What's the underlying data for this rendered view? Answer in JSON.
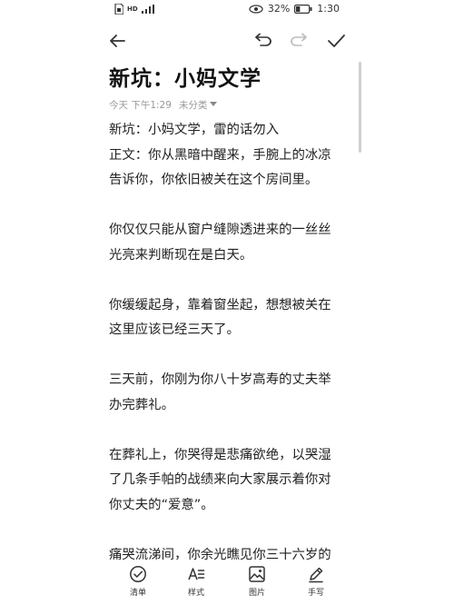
{
  "status_bar": {
    "signal_label": "HD",
    "battery_percent": "32%",
    "battery_level": 0.32,
    "time": "1:30"
  },
  "toolbar": {
    "icons": [
      "back-arrow-icon",
      "undo-icon",
      "redo-icon",
      "check-icon"
    ]
  },
  "note": {
    "title": "新坑：小妈文学",
    "date": "今天 下午1:29",
    "category": "未分类",
    "body": "新坑：小妈文学，雷的话勿入\n正文：你从黑暗中醒来，手腕上的冰凉\n告诉你，你依旧被关在这个房间里。\n\n你仅仅只能从窗户缝隙透进来的一丝丝\n光亮来判断现在是白天。\n\n你缓缓起身，靠着窗坐起，想想被关在\n这里应该已经三天了。\n\n三天前，你刚为你八十岁高寿的丈夫举\n办完葬礼。\n\n在葬礼上，你哭得是悲痛欲绝，以哭湿\n了几条手帕的战绩来向大家展示着你对\n你丈夫的“爱意”。\n\n痛哭流涕间，你余光瞧见你三十六岁的"
  },
  "bottom_bar": {
    "checklist": "清单",
    "style": "样式",
    "image": "图片",
    "handwrite": "手写"
  }
}
